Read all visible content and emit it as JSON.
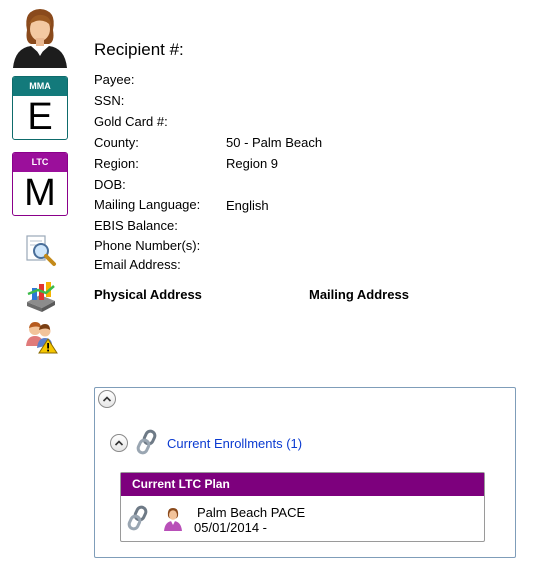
{
  "recipient": {
    "title": "Recipient #:",
    "fields": [
      {
        "label": "Payee:",
        "value": ""
      },
      {
        "label": "SSN:",
        "value": ""
      },
      {
        "label": "Gold Card #:",
        "value": ""
      },
      {
        "label": "County:",
        "value": "50 - Palm Beach"
      },
      {
        "label": "Region:",
        "value": "Region 9"
      },
      {
        "label": "DOB:",
        "value": ""
      },
      {
        "label": "Mailing Language:",
        "value": "English"
      },
      {
        "label": "EBIS Balance:",
        "value": ""
      },
      {
        "label": "Phone Number(s):",
        "value": ""
      },
      {
        "label": "Email Address:",
        "value": ""
      }
    ],
    "physical_address_label": "Physical Address",
    "mailing_address_label": "Mailing Address"
  },
  "badges": {
    "mma": {
      "band": "MMA",
      "letter": "E",
      "color": "#137a7b"
    },
    "ltc": {
      "band": "LTC",
      "letter": "M",
      "color": "#9b0f9b"
    }
  },
  "rail_icons": [
    "search-document-icon",
    "chart-report-icon",
    "people-warning-icon"
  ],
  "enrollments": {
    "link": "Current Enrollments (1)",
    "plan_header": "Current LTC Plan",
    "plan_header_color": "#7d007d",
    "plan_name": "Palm Beach PACE",
    "plan_dates": "05/01/2014 -"
  }
}
